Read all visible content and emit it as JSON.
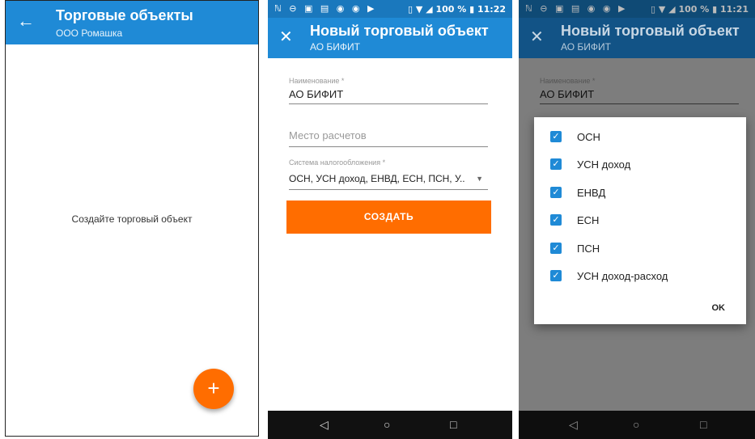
{
  "screen1": {
    "title": "Торговые объекты",
    "subtitle": "ООО Ромашка",
    "back_icon": "arrow-left-icon",
    "empty_text": "Создайте торговый объект",
    "fab_label": "+"
  },
  "screen2": {
    "status": {
      "left": "ℕ ⊖ ▣ ▤ ◉ ◉ ▶",
      "right": "▯ ▼ ◢ 100 % ▮ 11:22"
    },
    "title": "Новый торговый объект",
    "subtitle": "АО БИФИТ",
    "close_icon": "close-icon",
    "name_label": "Наименование *",
    "name_value": "АО БИФИТ",
    "place_placeholder": "Место расчетов",
    "tax_label": "Система налогообложения *",
    "tax_value": "ОСН, УСН доход, ЕНВД, ЕСН, ПСН, У..",
    "create_button": "СОЗДАТЬ",
    "nav": {
      "back": "◁",
      "home": "○",
      "recent": "□"
    }
  },
  "screen3": {
    "status": {
      "left": "ℕ ⊖ ▣ ▤ ◉ ◉ ▶",
      "right": "▯ ▼ ◢ 100 % ▮ 11:21"
    },
    "title": "Новый торговый объект",
    "subtitle": "АО БИФИТ",
    "name_label": "Наименование *",
    "name_value": "АО БИФИТ",
    "options": [
      {
        "label": "ОСН",
        "checked": true
      },
      {
        "label": "УСН доход",
        "checked": true
      },
      {
        "label": "ЕНВД",
        "checked": true
      },
      {
        "label": "ЕСН",
        "checked": true
      },
      {
        "label": "ПСН",
        "checked": true
      },
      {
        "label": "УСН доход-расход",
        "checked": true
      }
    ],
    "ok_button": "OK",
    "nav": {
      "back": "◁",
      "home": "○",
      "recent": "□"
    }
  },
  "colors": {
    "primary": "#1f8ad6",
    "accent": "#ff6d00"
  }
}
